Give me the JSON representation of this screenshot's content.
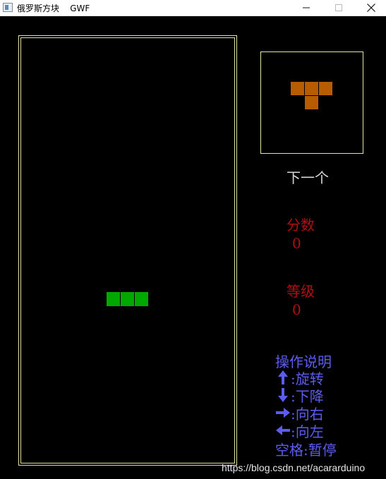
{
  "window": {
    "title": "俄罗斯方块    GWF",
    "minimize_label": "—",
    "close_label": "✕"
  },
  "board": {
    "current_piece": "I-piece (partial)",
    "piece_color": "#00a800",
    "border_color": "#e6e2a0"
  },
  "preview": {
    "piece": "T",
    "piece_color": "#b85c00"
  },
  "labels": {
    "next": "下一个",
    "score": "分数",
    "level": "等级"
  },
  "stats": {
    "score": "0",
    "level": "0"
  },
  "help": {
    "title": "操作说明",
    "rows": [
      {
        "icon": "arrow-up-icon",
        "text": ":旋转"
      },
      {
        "icon": "arrow-down-icon",
        "text": ":下降"
      },
      {
        "icon": "arrow-right-icon",
        "text": ":向右"
      },
      {
        "icon": "arrow-left-icon",
        "text": ":向左"
      }
    ],
    "space": "空格:暂停"
  },
  "watermark": "https://blog.csdn.net/acararduino",
  "colors": {
    "background": "#000000",
    "label_red": "#b01010",
    "help_blue": "#5c5cf0",
    "next_label": "#d8d8d8"
  }
}
